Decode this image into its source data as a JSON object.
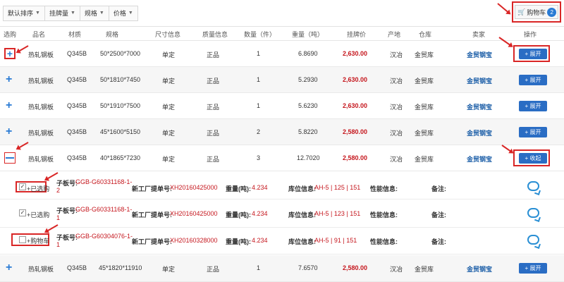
{
  "filters": {
    "sort_default": "默认排序",
    "sort_price_tag": "挂牌量",
    "sort_spec": "规格",
    "sort_price": "价格"
  },
  "cart": {
    "label": "购物车",
    "count": "2",
    "icon": "shopping-cart-icon"
  },
  "columns": [
    "选购",
    "品名",
    "材质",
    "规格",
    "尺寸信息",
    "质量信息",
    "数量（件）",
    "重量（吨）",
    "挂牌价",
    "产地",
    "仓库",
    "卖家",
    "操作"
  ],
  "rows": [
    {
      "name": "热轧钢板",
      "material": "Q345B",
      "spec": "50*2500*7000",
      "size": "单定",
      "quality": "正品",
      "qty": "1",
      "weight": "6.8690",
      "price": "2,630.00",
      "origin": "汉冶",
      "warehouse": "金贸库",
      "seller": "金贸钢宝",
      "action": "+ 展开"
    },
    {
      "name": "热轧钢板",
      "material": "Q345B",
      "spec": "50*1810*7450",
      "size": "单定",
      "quality": "正品",
      "qty": "1",
      "weight": "5.2930",
      "price": "2,630.00",
      "origin": "汉冶",
      "warehouse": "金贸库",
      "seller": "金贸钢宝",
      "action": "+ 展开"
    },
    {
      "name": "热轧钢板",
      "material": "Q345B",
      "spec": "50*1910*7500",
      "size": "单定",
      "quality": "正品",
      "qty": "1",
      "weight": "5.6230",
      "price": "2,630.00",
      "origin": "汉冶",
      "warehouse": "金贸库",
      "seller": "金贸钢宝",
      "action": "+ 展开"
    },
    {
      "name": "热轧钢板",
      "material": "Q345B",
      "spec": "45*1600*5150",
      "size": "单定",
      "quality": "正品",
      "qty": "2",
      "weight": "5.8220",
      "price": "2,580.00",
      "origin": "汉冶",
      "warehouse": "金贸库",
      "seller": "金贸钢宝",
      "action": "+ 展开"
    },
    {
      "name": "热轧钢板",
      "material": "Q345B",
      "spec": "40*1865*7230",
      "size": "单定",
      "quality": "正品",
      "qty": "3",
      "weight": "12.7020",
      "price": "2,580.00",
      "origin": "汉冶",
      "warehouse": "金贸库",
      "seller": "金贸钢宝",
      "action": "+ 收起"
    },
    {
      "name": "热轧钢板",
      "material": "Q345B",
      "spec": "45*1820*11910",
      "size": "单定",
      "quality": "正品",
      "qty": "1",
      "weight": "7.6570",
      "price": "2,580.00",
      "origin": "汉冶",
      "warehouse": "金贸库",
      "seller": "金贸钢宝",
      "action": "+ 展开"
    }
  ],
  "sub_rows": [
    {
      "status": "+已选购",
      "plate_label": "子板号:",
      "plate_no_1": "GGB-G60331168-1-",
      "plate_no_2": "2",
      "bill_label": "新工厂提单号:",
      "bill_no": "XH20160425000",
      "weight_label": "重量(吨):",
      "weight": "4.234",
      "loc_label": "库位信息:",
      "loc": "AH-5 | 125 | 151",
      "perf_label": "性能信息:",
      "note_label": "备注:"
    },
    {
      "status": "+已选购",
      "plate_label": "子板号:",
      "plate_no_1": "GGB-G60331168-1-",
      "plate_no_2": "1",
      "bill_label": "新工厂提单号:",
      "bill_no": "XH20160425000",
      "weight_label": "重量(吨):",
      "weight": "4.234",
      "loc_label": "库位信息:",
      "loc": "AH-5 | 123 | 151",
      "perf_label": "性能信息:",
      "note_label": "备注:"
    },
    {
      "status": "+购物车",
      "plate_label": "子板号:",
      "plate_no_1": "GGB-G60304076-1-",
      "plate_no_2": "1",
      "bill_label": "新工厂提单号:",
      "bill_no": "XH20160328000",
      "weight_label": "重量(吨):",
      "weight": "4.234",
      "loc_label": "库位信息:",
      "loc": "AH-5 | 91 | 151",
      "perf_label": "性能信息:",
      "note_label": "备注:"
    }
  ],
  "colors": {
    "accent": "#2a6dc4",
    "price": "#c5161d",
    "annotation": "#d92626"
  }
}
